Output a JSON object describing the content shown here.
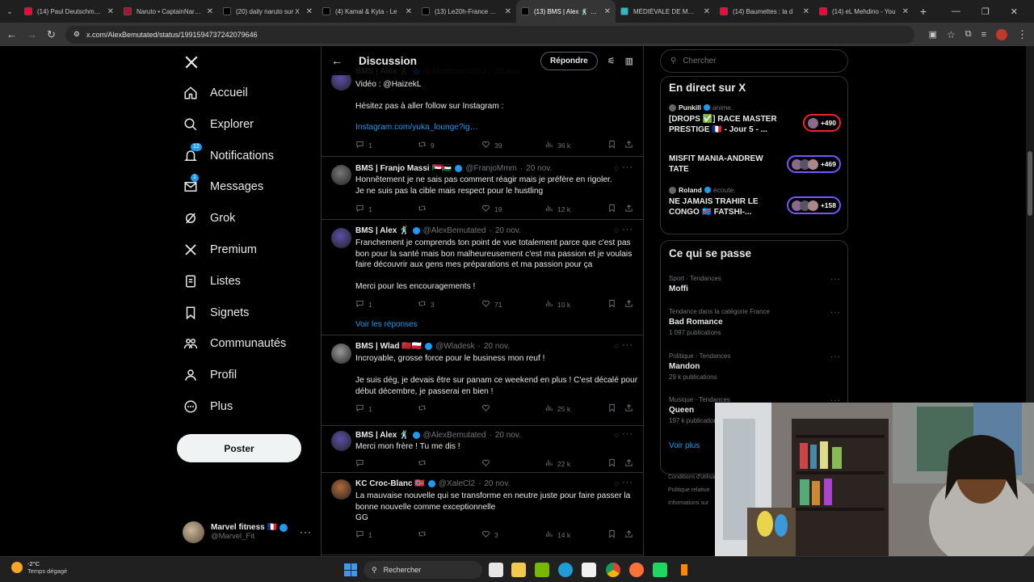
{
  "browser": {
    "tabs": [
      {
        "label": "(14) Paul Deutschmann",
        "color": "#ff0033"
      },
      {
        "label": "Naruto • CaptainNaruto",
        "color": "#b0102f"
      },
      {
        "label": "(20) daily naruto sur X",
        "color": "#000000"
      },
      {
        "label": "(4) Kamal & Kyta - Le",
        "color": "#000000"
      },
      {
        "label": "(13) Le20h-France Télé",
        "color": "#000000"
      },
      {
        "label": "(13) BMS | Alex 🕺 sur X",
        "color": "#000000",
        "active": true
      },
      {
        "label": "MÉDIÉVALE DE MANTES",
        "color": "#2db7c7"
      },
      {
        "label": "(14) Baumettes : la d",
        "color": "#ff0033"
      },
      {
        "label": "(14) eL Mehdino - You",
        "color": "#ff0033"
      }
    ],
    "url": "x.com/AlexBemutated/status/1991594737242079646"
  },
  "nav": {
    "items": [
      {
        "label": "Accueil",
        "icon": "home-icon"
      },
      {
        "label": "Explorer",
        "icon": "search-icon"
      },
      {
        "label": "Notifications",
        "icon": "bell-icon",
        "badge": "12"
      },
      {
        "label": "Messages",
        "icon": "mail-icon",
        "badge": "1"
      },
      {
        "label": "Grok",
        "icon": "grok-icon"
      },
      {
        "label": "Premium",
        "icon": "x-logo-icon"
      },
      {
        "label": "Listes",
        "icon": "list-icon"
      },
      {
        "label": "Signets",
        "icon": "bookmark-icon"
      },
      {
        "label": "Communautés",
        "icon": "communities-icon"
      },
      {
        "label": "Profil",
        "icon": "profile-icon"
      },
      {
        "label": "Plus",
        "icon": "more-circle-icon"
      }
    ],
    "post_label": "Poster",
    "account": {
      "name": "Marvel fitness 🇫🇷",
      "handle": "@Marvel_Fit"
    }
  },
  "main": {
    "title": "Discussion",
    "reply_label": "Répondre",
    "tweets": [
      {
        "name": "BMS | Alex 🕺",
        "handle": "@AlexBemutated",
        "date": "20 nov.",
        "lines": [
          "Vidéo : @HaizekL",
          "",
          "Hésitez pas à aller follow sur Instagram :",
          "",
          "Instagram.com/yuka_lounge?ig…"
        ],
        "replies": "1",
        "retweets": "9",
        "likes": "39",
        "views": "36 k"
      },
      {
        "name": "BMS | Franjo Massi 🇸🇩🇵🇸",
        "handle": "@FranjoMmm",
        "date": "20 nov.",
        "text": "Honnêtement je ne sais pas comment réagir mais je préfère en rigoler.\nJe ne suis pas la cible mais respect pour le hustling",
        "replies": "1",
        "retweets": "",
        "likes": "19",
        "views": "12 k"
      },
      {
        "name": "BMS | Alex 🕺",
        "handle": "@AlexBemutated",
        "date": "20 nov.",
        "text": "Franchement je comprends ton point de vue totalement parce que c'est pas bon pour la santé mais bon malheureusement c'est ma passion et je voulais faire découvrir aux gens mes préparations et ma passion pour ça\n\nMerci pour les encouragements !",
        "replies": "1",
        "retweets": "3",
        "likes": "71",
        "views": "10 k",
        "see_replies": "Voir les réponses"
      },
      {
        "name": "BMS | Wlad 🇲🇦🇵🇱",
        "handle": "@Wladesk",
        "date": "20 nov.",
        "text": "Incroyable, grosse force pour le business mon reuf !\n\nJe suis dég, je devais être sur panam ce weekend en plus ! C'est décalé pour début décembre, je passerai en bien !",
        "replies": "1",
        "retweets": "",
        "likes": "",
        "views": "25 k"
      },
      {
        "name": "BMS | Alex 🕺",
        "handle": "@AlexBemutated",
        "date": "20 nov.",
        "text": "Merci mon frère ! Tu me dis !",
        "replies": "",
        "retweets": "",
        "likes": "",
        "views": "22 k"
      },
      {
        "name": "KC Croc-Blanc 🇳🇴",
        "handle": "@XaleCl2",
        "date": "20 nov.",
        "text": "La mauvaise nouvelle qui se transforme en neutre juste pour faire passer la bonne nouvelle comme exceptionnelle\nGG",
        "replies": "1",
        "retweets": "",
        "likes": "3",
        "views": "14 k"
      }
    ]
  },
  "sidebar": {
    "search_placeholder": "Chercher",
    "live_title": "En direct sur X",
    "lives": [
      {
        "host": "Punkill",
        "verb": "anime.",
        "title": "[DROPS ✅] RACE MASTER PRESTIGE 🇫🇷 - Jour 5 - ...",
        "count": "+490",
        "color": "#f4212e"
      },
      {
        "host": "",
        "verb": "",
        "title": "MISFIT MANIA-ANDREW TATE",
        "count": "+469",
        "color": "#7856ff"
      },
      {
        "host": "Roland",
        "verb": "écoute.",
        "title": "NE JAMAIS TRAHIR LE CONGO 🇨🇩 FATSHI-...",
        "count": "+158",
        "color": "#7856ff"
      }
    ],
    "trends_title": "Ce qui se passe",
    "trends": [
      {
        "category": "Sport · Tendances",
        "name": "Moffi",
        "count": ""
      },
      {
        "category": "Tendance dans la catégorie France",
        "name": "Bad Romance",
        "count": "1 097 publications"
      },
      {
        "category": "Politique · Tendances",
        "name": "Mandon",
        "count": "29 k publications"
      },
      {
        "category": "Musique · Tendances",
        "name": "Queen",
        "count": "197 k publications"
      }
    ],
    "show_more": "Voir plus",
    "footer": [
      "Conditions d'utilisation",
      "Politique relative",
      "Informations sur"
    ]
  },
  "taskbar": {
    "weather_temp": "-2°C",
    "weather_desc": "Temps dégagé",
    "search_placeholder": "Rechercher"
  }
}
